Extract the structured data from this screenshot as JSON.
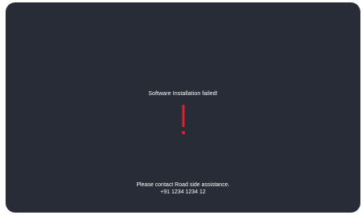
{
  "dialog": {
    "title": "Software Installation failed!",
    "icon": "exclamation-icon",
    "accent_color": "#e0202b",
    "background_color": "#282c37"
  },
  "footer": {
    "line1": "Please contact Road side assistance.",
    "line2": "+91 1234 1234 12"
  }
}
